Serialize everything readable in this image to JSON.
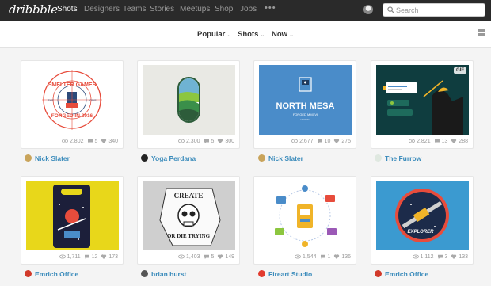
{
  "nav": {
    "logo": "dribbble",
    "links": [
      "Shots",
      "Designers",
      "Teams",
      "Stories",
      "Meetups",
      "Shop",
      "Jobs"
    ],
    "more": "•••",
    "search_placeholder": "Search"
  },
  "filters": {
    "sort": "Popular",
    "type": "Shots",
    "time": "Now"
  },
  "shots": [
    {
      "author": "Nick Slater",
      "views": "2,802",
      "comments": "5",
      "likes": "340",
      "art_title_1": "SMELTER GAMES",
      "art_title_2": "FORGED IN 2016",
      "art_left": "THE",
      "art_right": "GDS"
    },
    {
      "author": "Yoga Perdana",
      "views": "2,300",
      "comments": "5",
      "likes": "300"
    },
    {
      "author": "Nick Slater",
      "views": "2,677",
      "comments": "10",
      "likes": "275",
      "art_title": "NORTH MESA",
      "art_sub": "FORGED MMXVI",
      "art_sub2": "ARIZONA"
    },
    {
      "author": "The Furrow",
      "views": "2,821",
      "comments": "13",
      "likes": "288",
      "badge": "GIF"
    },
    {
      "author": "Emrich Office",
      "views": "1,711",
      "comments": "12",
      "likes": "173"
    },
    {
      "author": "brian hurst",
      "views": "1,403",
      "comments": "5",
      "likes": "149",
      "art_title_1": "CREATE",
      "art_title_2": "OR DIE TRYING"
    },
    {
      "author": "Fireart Studio",
      "views": "1,544",
      "comments": "1",
      "likes": "136"
    },
    {
      "author": "Emrich Office",
      "views": "1,112",
      "comments": "3",
      "likes": "133",
      "art_title": "EXPLORER"
    }
  ]
}
